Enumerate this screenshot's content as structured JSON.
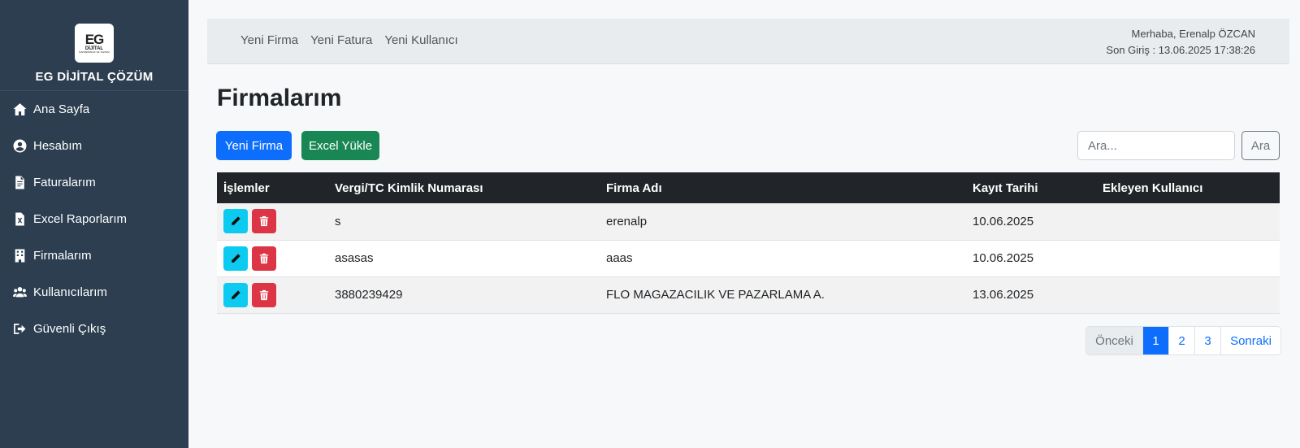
{
  "brand": {
    "logo_main": "EG",
    "logo_sub": "DİJİTAL",
    "logo_tiny": "DANIŞMANLIK VE YAZILIM",
    "name": "EG DİJİTAL ÇÖZÜM"
  },
  "sidebar": {
    "items": [
      {
        "label": "Ana Sayfa",
        "icon": "home-icon"
      },
      {
        "label": "Hesabım",
        "icon": "user-circle-icon"
      },
      {
        "label": "Faturalarım",
        "icon": "invoice-icon"
      },
      {
        "label": "Excel Raporlarım",
        "icon": "excel-file-icon"
      },
      {
        "label": "Firmalarım",
        "icon": "building-icon"
      },
      {
        "label": "Kullanıcılarım",
        "icon": "users-icon"
      },
      {
        "label": "Güvenli Çıkış",
        "icon": "logout-icon"
      }
    ]
  },
  "topbar": {
    "links": [
      "Yeni Firma",
      "Yeni Fatura",
      "Yeni Kullanıcı"
    ],
    "greeting": "Merhaba, Erenalp ÖZCAN",
    "last_login": "Son Giriş : 13.06.2025 17:38:26"
  },
  "main": {
    "title": "Firmalarım",
    "new_button": "Yeni Firma",
    "excel_button": "Excel Yükle",
    "search_placeholder": "Ara...",
    "search_value": "",
    "search_button": "Ara"
  },
  "table": {
    "headers": [
      "İşlemler",
      "Vergi/TC Kimlik Numarası",
      "Firma Adı",
      "Kayıt Tarihi",
      "Ekleyen Kullanıcı"
    ],
    "rows": [
      {
        "vkn": "s",
        "firma": "erenalp",
        "date": "10.06.2025",
        "user": ""
      },
      {
        "vkn": "asasas",
        "firma": "aaas",
        "date": "10.06.2025",
        "user": ""
      },
      {
        "vkn": "3880239429",
        "firma": "FLO MAGAZACILIK VE PAZARLAMA A.",
        "date": "13.06.2025",
        "user": ""
      }
    ]
  },
  "pagination": {
    "prev": "Önceki",
    "pages": [
      "1",
      "2",
      "3"
    ],
    "active_page": "1",
    "next": "Sonraki"
  },
  "colors": {
    "sidebar_bg": "#2c3e50",
    "primary": "#0d6efd",
    "success": "#198754",
    "info": "#0dcaf0",
    "danger": "#dc3545",
    "table_header": "#212529"
  }
}
